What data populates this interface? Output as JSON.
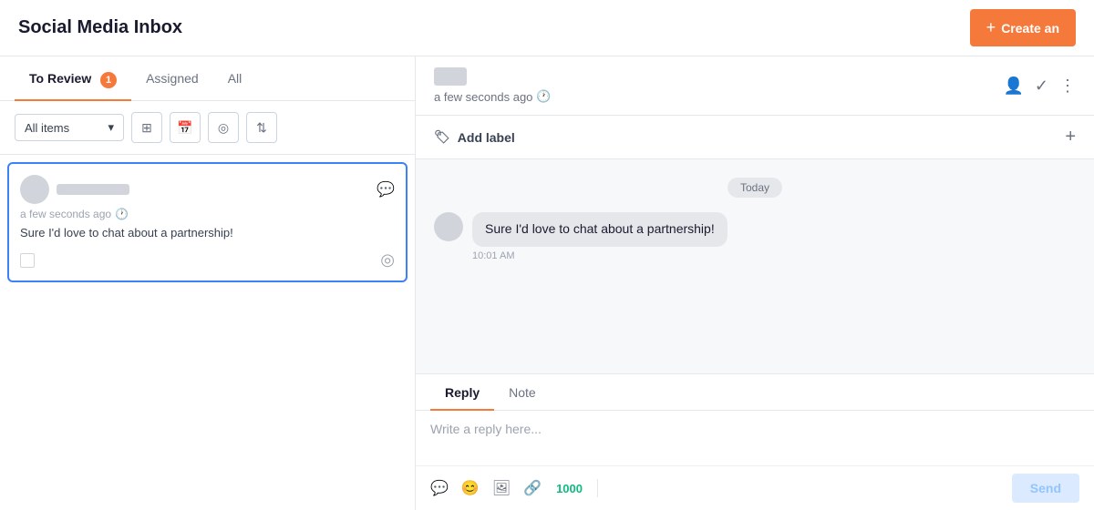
{
  "header": {
    "title": "Social Media Inbox",
    "create_button": "Create an"
  },
  "left_panel": {
    "tabs": [
      {
        "label": "To Review",
        "badge": "1",
        "active": true
      },
      {
        "label": "Assigned",
        "active": false
      },
      {
        "label": "All",
        "active": false
      }
    ],
    "filter": {
      "label": "All items",
      "placeholder": "All items"
    },
    "conversations": [
      {
        "timestamp": "a few seconds ago",
        "message": "Sure I'd love to chat about a partnership!"
      }
    ]
  },
  "right_panel": {
    "timestamp": "a few seconds ago",
    "label_bar": {
      "label": "Add label"
    },
    "date_badge": "Today",
    "message": {
      "text": "Sure I'd love to chat about a partnership!",
      "time": "10:01 AM"
    },
    "reply_tabs": [
      {
        "label": "Reply",
        "active": true
      },
      {
        "label": "Note",
        "active": false
      }
    ],
    "reply_placeholder": "Write a reply here...",
    "char_count": "1000",
    "send_label": "Send"
  }
}
